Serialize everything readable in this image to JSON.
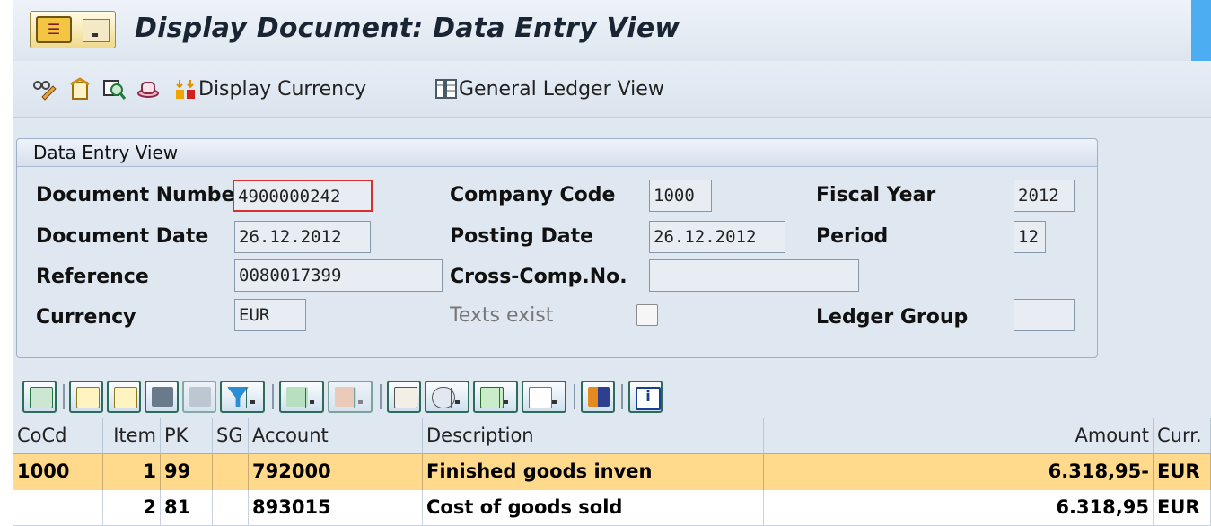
{
  "header": {
    "title": "Display Document: Data Entry View"
  },
  "toolbar": {
    "display_currency": "Display Currency",
    "general_ledger_view": "General Ledger View"
  },
  "frame": {
    "title": "Data Entry View",
    "fields": {
      "document_number_label": "Document Numbe",
      "document_number": "4900000242",
      "company_code_label": "Company Code",
      "company_code": "1000",
      "fiscal_year_label": "Fiscal Year",
      "fiscal_year": "2012",
      "document_date_label": "Document Date",
      "document_date": "26.12.2012",
      "posting_date_label": "Posting Date",
      "posting_date": "26.12.2012",
      "period_label": "Period",
      "period": "12",
      "reference_label": "Reference",
      "reference": "0080017399",
      "cross_comp_label": "Cross-Comp.No.",
      "cross_comp": "",
      "currency_label": "Currency",
      "currency": "EUR",
      "texts_exist_label": "Texts exist",
      "ledger_group_label": "Ledger Group",
      "ledger_group": ""
    }
  },
  "grid": {
    "columns": [
      "CoCd",
      "Item",
      "PK",
      "SG",
      "Account",
      "Description",
      "Amount",
      "Curr."
    ],
    "rows": [
      {
        "cocd": "1000",
        "item": "1",
        "pk": "99",
        "sg": "",
        "account": "792000",
        "description": "Finished goods inven",
        "amount": "6.318,95-",
        "curr": "EUR"
      },
      {
        "cocd": "",
        "item": "2",
        "pk": "81",
        "sg": "",
        "account": "893015",
        "description": "Cost of goods sold",
        "amount": "6.318,95",
        "curr": "EUR"
      }
    ]
  },
  "colors": {
    "selected_row": "#ffd98c",
    "background": "#dfe7f0",
    "accent_blue": "#4dadf3"
  }
}
